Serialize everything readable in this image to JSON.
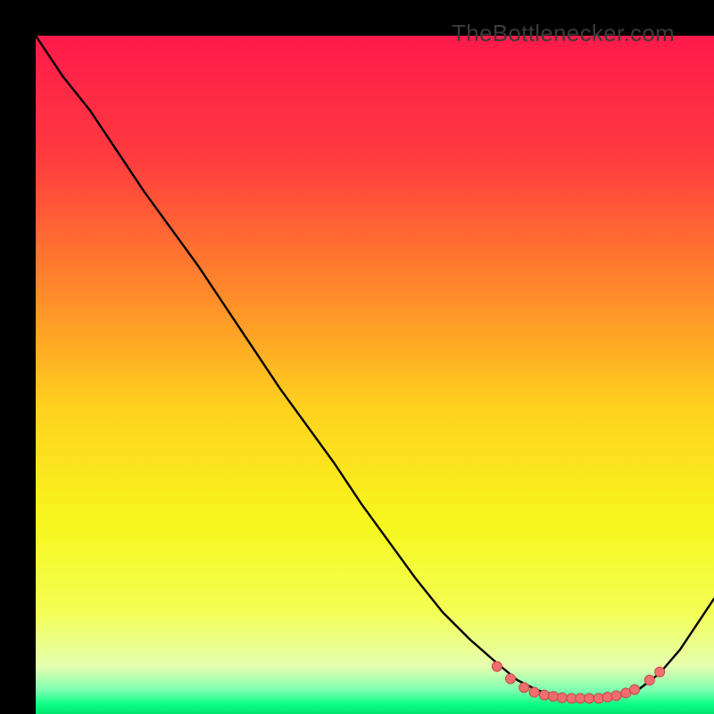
{
  "watermark": "TheBottlenecker.com",
  "chart_data": {
    "type": "line",
    "title": "",
    "xlabel": "",
    "ylabel": "",
    "xlim": [
      0,
      100
    ],
    "ylim": [
      0,
      100
    ],
    "background_gradient": {
      "stops": [
        {
          "offset": 0.0,
          "color": "#ff1a4b"
        },
        {
          "offset": 0.18,
          "color": "#ff3b3f"
        },
        {
          "offset": 0.38,
          "color": "#ff8a2a"
        },
        {
          "offset": 0.55,
          "color": "#ffd21f"
        },
        {
          "offset": 0.72,
          "color": "#f7f71e"
        },
        {
          "offset": 0.85,
          "color": "#f3ff55"
        },
        {
          "offset": 0.93,
          "color": "#e6ffb0"
        },
        {
          "offset": 0.965,
          "color": "#7dffb0"
        },
        {
          "offset": 0.985,
          "color": "#0fff86"
        },
        {
          "offset": 1.0,
          "color": "#00e56e"
        }
      ]
    },
    "series": [
      {
        "name": "bottleneck-curve",
        "color": "#000000",
        "x": [
          0,
          4,
          8,
          12,
          16,
          20,
          24,
          28,
          32,
          36,
          40,
          44,
          48,
          52,
          56,
          60,
          64,
          68,
          71,
          74,
          77,
          80,
          83,
          86,
          89,
          92,
          95,
          100
        ],
        "y": [
          100,
          94,
          89,
          83,
          77,
          71.5,
          66,
          60,
          54,
          48,
          42.5,
          37,
          31,
          25.5,
          20,
          15,
          11,
          7.5,
          5,
          3.5,
          2.7,
          2.3,
          2.3,
          2.7,
          3.7,
          6,
          9.5,
          17
        ]
      }
    ],
    "marker_cluster": {
      "name": "recommended-range",
      "color": "#ef6f6f",
      "border": "#c44",
      "points": [
        {
          "x": 68,
          "y": 7.0
        },
        {
          "x": 70,
          "y": 5.2
        },
        {
          "x": 72,
          "y": 3.9
        },
        {
          "x": 73.5,
          "y": 3.2
        },
        {
          "x": 75,
          "y": 2.8
        },
        {
          "x": 76.3,
          "y": 2.6
        },
        {
          "x": 77.6,
          "y": 2.4
        },
        {
          "x": 79,
          "y": 2.3
        },
        {
          "x": 80.3,
          "y": 2.3
        },
        {
          "x": 81.6,
          "y": 2.3
        },
        {
          "x": 83,
          "y": 2.3
        },
        {
          "x": 84.3,
          "y": 2.5
        },
        {
          "x": 85.6,
          "y": 2.7
        },
        {
          "x": 87,
          "y": 3.1
        },
        {
          "x": 88.3,
          "y": 3.6
        },
        {
          "x": 90.5,
          "y": 5.0
        },
        {
          "x": 92,
          "y": 6.2
        }
      ]
    }
  }
}
